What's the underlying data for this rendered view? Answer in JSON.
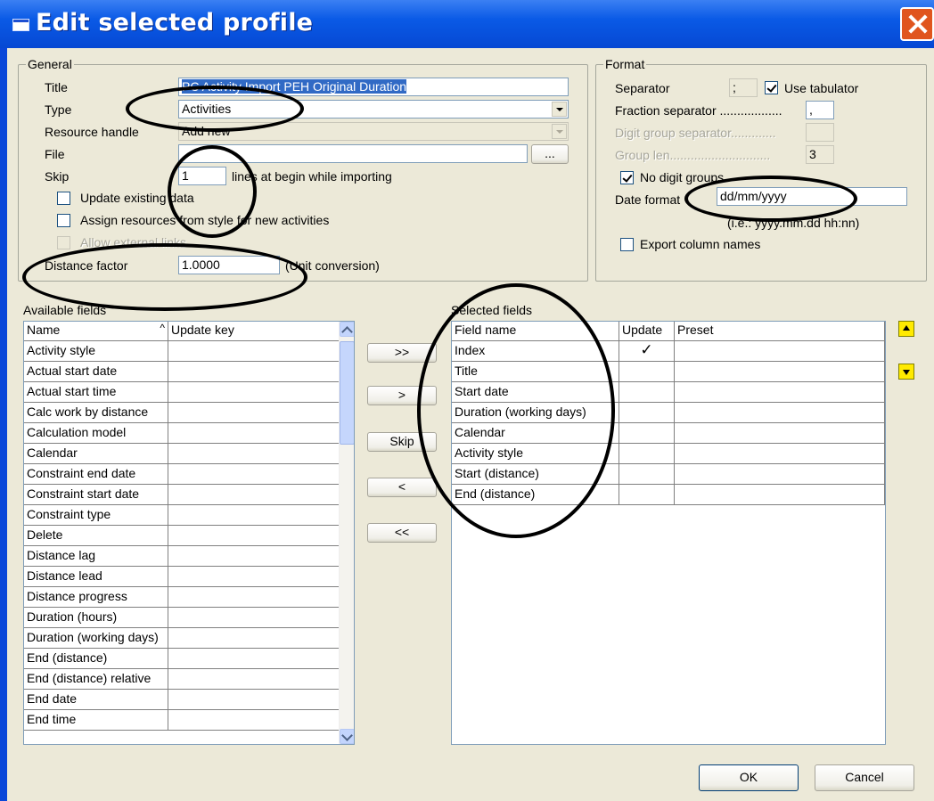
{
  "window": {
    "title": "Edit selected profile"
  },
  "general": {
    "group_label": "General",
    "title_label": "Title",
    "title_value": "PC Activity Import PEH Original Duration",
    "type_label": "Type",
    "type_value": "Activities",
    "resource_label": "Resource handle",
    "resource_value": "Add new",
    "file_label": "File",
    "file_value": "",
    "browse_label": "...",
    "skip_label": "Skip",
    "skip_value": "1",
    "skip_suffix": "lines at begin while importing",
    "update_existing": "Update existing data",
    "assign_resources": "Assign resources from style for new activities",
    "allow_external": "Allow external links",
    "distance_label": "Distance factor",
    "distance_value": "1.0000",
    "distance_suffix": "(Unit conversion)"
  },
  "format": {
    "group_label": "Format",
    "separator_label": "Separator",
    "separator_value": ";",
    "use_tabulator": "Use tabulator",
    "fraction_label": "Fraction separator ..................",
    "fraction_value": ",",
    "digit_group_label": "Digit group separator.............",
    "digit_group_value": "",
    "group_len_label": "Group len.............................",
    "group_len_value": "3",
    "no_digit_groups": "No digit groups",
    "date_format_label": "Date format",
    "date_format_value": "dd/mm/yyyy",
    "date_hint": "(i.e.: yyyy.mm.dd hh:nn)",
    "export_column_names": "Export column names"
  },
  "available": {
    "label": "Available fields",
    "col_name": "Name",
    "col_update_key": "Update key",
    "rows": [
      "Activity style",
      "Actual start date",
      "Actual start time",
      "Calc work by distance",
      "Calculation model",
      "Calendar",
      "Constraint end date",
      "Constraint start date",
      "Constraint type",
      "Delete",
      "Distance lag",
      "Distance lead",
      "Distance progress",
      "Duration (hours)",
      "Duration (working days)",
      "End (distance)",
      "End (distance) relative",
      "End date",
      "End time"
    ]
  },
  "transfer": {
    "add_all": ">>",
    "add": ">",
    "skip": "Skip",
    "remove": "<",
    "remove_all": "<<"
  },
  "selected": {
    "label": "Selected fields",
    "col_field": "Field name",
    "col_update": "Update",
    "col_preset": "Preset",
    "rows": [
      {
        "name": "Index",
        "update": "✓",
        "preset": ""
      },
      {
        "name": "Title",
        "update": "",
        "preset": ""
      },
      {
        "name": "Start date",
        "update": "",
        "preset": ""
      },
      {
        "name": "Duration (working days)",
        "update": "",
        "preset": ""
      },
      {
        "name": "Calendar",
        "update": "",
        "preset": ""
      },
      {
        "name": "Activity style",
        "update": "",
        "preset": ""
      },
      {
        "name": "Start (distance)",
        "update": "",
        "preset": ""
      },
      {
        "name": "End (distance)",
        "update": "",
        "preset": ""
      }
    ]
  },
  "buttons": {
    "ok": "OK",
    "cancel": "Cancel"
  }
}
